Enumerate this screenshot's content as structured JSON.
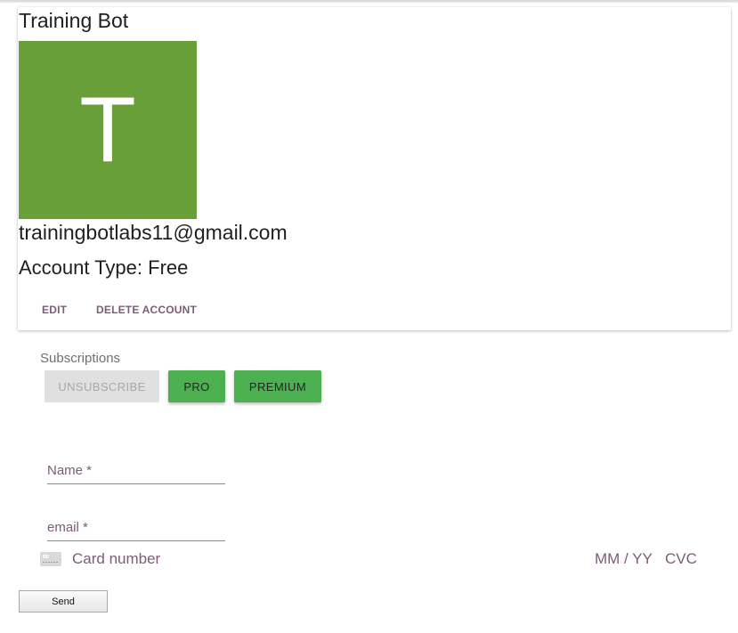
{
  "profile": {
    "name": "Training Bot",
    "avatar_letter": "T",
    "email": "trainingbotlabs11@gmail.com",
    "account_type": "Account Type: Free",
    "edit_label": "EDIT",
    "delete_label": "DELETE ACCOUNT"
  },
  "subscriptions": {
    "label": "Subscriptions",
    "unsubscribe_label": "UNSUBSCRIBE",
    "pro_label": "PRO",
    "premium_label": "PREMIUM"
  },
  "form": {
    "name_label": "Name *",
    "email_label": "email *",
    "card_number_placeholder": "Card number",
    "expiry_placeholder": "MM / YY",
    "cvc_placeholder": "CVC",
    "send_label": "Send"
  },
  "colors": {
    "avatar_bg": "#689f38",
    "button_green": "#4caf50",
    "text_purple": "#7b5c79",
    "disabled_bg": "#e0e0e0"
  },
  "icons": {
    "card": "credit-card-icon"
  }
}
